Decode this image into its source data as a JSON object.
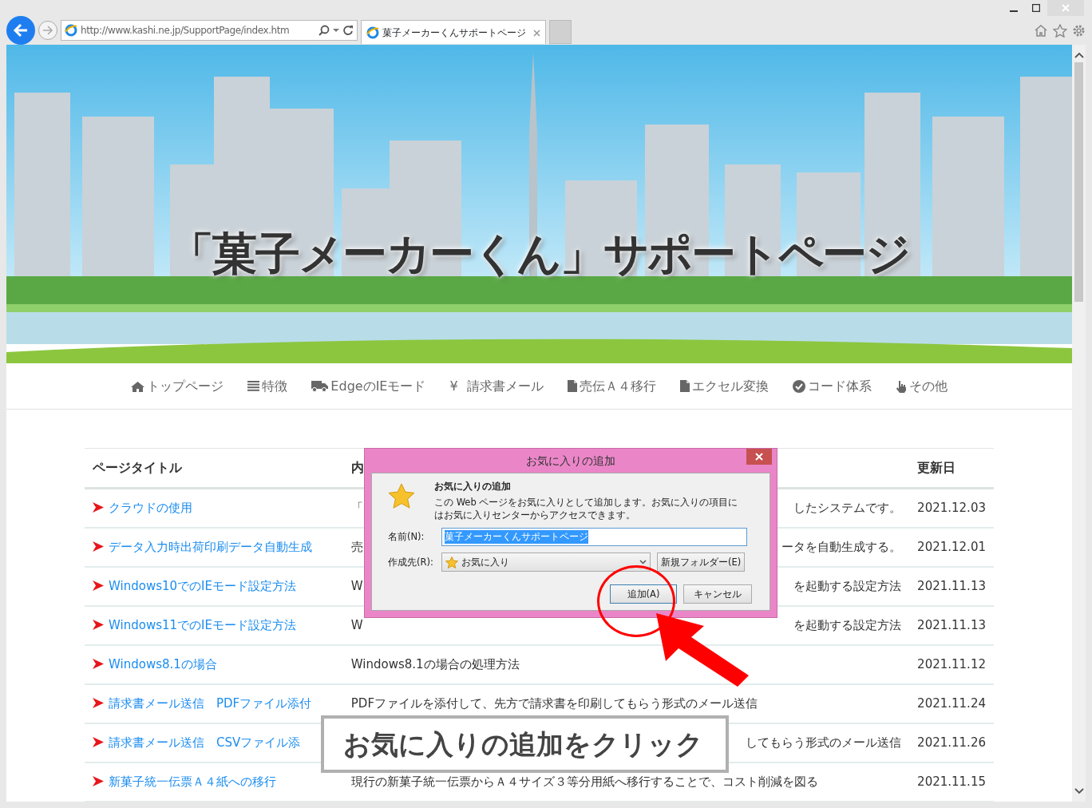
{
  "browser": {
    "url": "http://www.kashi.ne.jp/SupportPage/index.htm",
    "tabs": [
      {
        "title": "菓子メーカーくんサポートページ",
        "selected": true
      }
    ]
  },
  "hero": {
    "title": "「菓子メーカーくん」サポートページ"
  },
  "nav": [
    {
      "label": "トップページ"
    },
    {
      "label": "特徴"
    },
    {
      "label": "EdgeのIEモード"
    },
    {
      "char": "¥",
      "label": "請求書メール"
    },
    {
      "label": "売伝Ａ４移行"
    },
    {
      "label": "エクセル変換"
    },
    {
      "label": "コード体系"
    },
    {
      "label": "その他"
    }
  ],
  "table": {
    "columns": [
      "ページタイトル",
      "内",
      "更新日"
    ],
    "rows": [
      {
        "title": "クラウドの使用",
        "content_start": "「",
        "content_end": "したシステムです。",
        "date": "2021.12.03"
      },
      {
        "title": "データ入力時出荷印刷データ自動生成",
        "content_start": "売",
        "content_end": "ータを自動生成する。",
        "date": "2021.12.01"
      },
      {
        "title": "Windows10でのIEモード設定方法",
        "content_start": "W",
        "content_end": "を起動する設定方法",
        "date": "2021.11.13"
      },
      {
        "title": "Windows11でのIEモード設定方法",
        "content_start": "W",
        "content_end": "を起動する設定方法",
        "date": "2021.11.13"
      },
      {
        "title": "Windows8.1の場合",
        "content": "Windows8.1の場合の処理方法",
        "date": "2021.11.12"
      },
      {
        "title": "請求書メール送信　PDFファイル添付",
        "content": "PDFファイルを添付して、先方で請求書を印刷してもらう形式のメール送信",
        "date": "2021.11.24"
      },
      {
        "title": "請求書メール送信　CSVファイル添",
        "content_end": "してもらう形式のメール送信",
        "date": "2021.11.26"
      },
      {
        "title": "新菓子統一伝票Ａ４紙への移行",
        "content": "現行の新菓子統一伝票からＡ４サイズ３等分用紙へ移行することで、コスト削減を図る",
        "date": "2021.11.15"
      }
    ]
  },
  "dialog": {
    "title": "お気に入りの追加",
    "heading": "お気に入りの追加",
    "description": "この Web ページをお気に入りとして追加します。お気に入りの項目にはお気に入りセンターからアクセスできます。",
    "name_label": "名前(N):",
    "name_value": "菓子メーカーくんサポートページ",
    "name_selected": true,
    "folder_label": "作成先(R):",
    "folder_value": "お気に入り",
    "buttons": [
      {
        "label": "新規フォルダー(E)",
        "kind": "folder"
      },
      {
        "label": "追加(A)",
        "kind": "default"
      },
      {
        "label": "キャンセル",
        "kind": "normal"
      }
    ]
  },
  "callout": {
    "text": "お気に入りの追加をクリック"
  }
}
